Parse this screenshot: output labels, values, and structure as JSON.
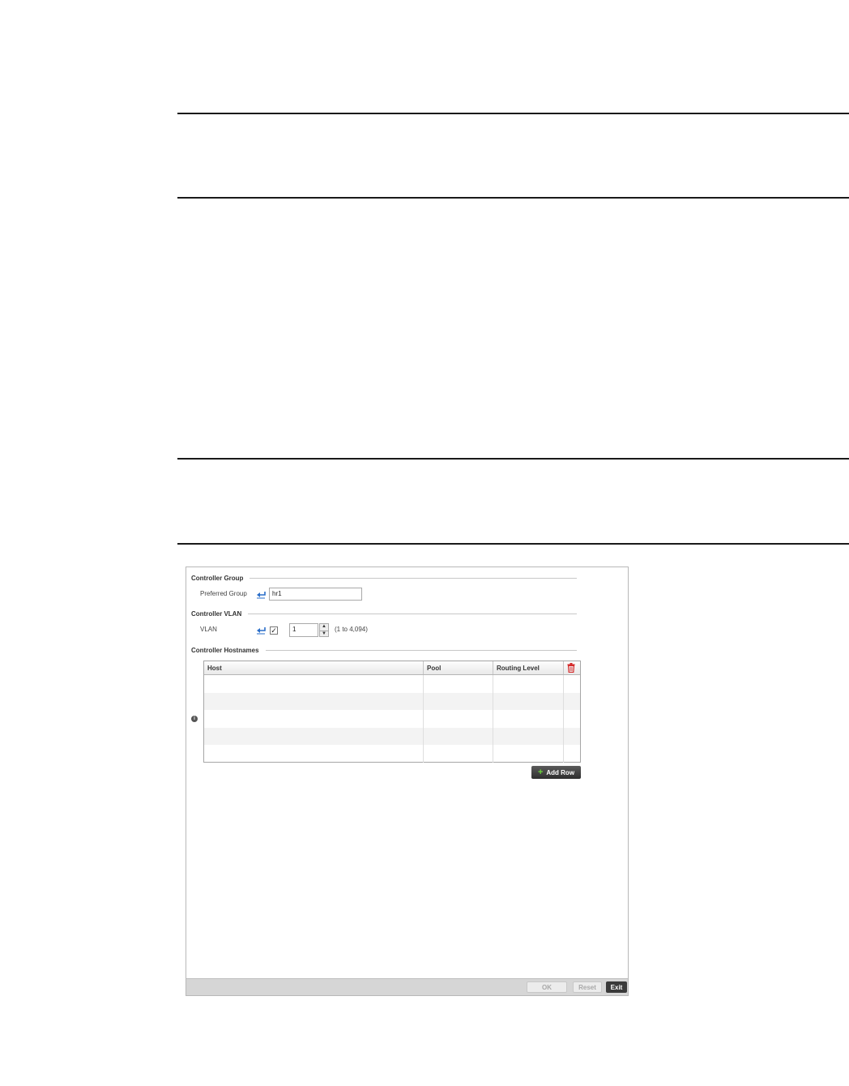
{
  "form": {
    "controller_group": {
      "title": "Controller Group",
      "preferred_group_label": "Preferred Group",
      "preferred_group_value": "hr1"
    },
    "controller_vlan": {
      "title": "Controller VLAN",
      "vlan_label": "VLAN",
      "vlan_checked": "✓",
      "vlan_value": "1",
      "vlan_range": "(1 to 4,094)"
    },
    "controller_hostnames": {
      "title": "Controller Hostnames",
      "columns": {
        "host": "Host",
        "pool": "Pool",
        "routing_level": "Routing Level"
      },
      "info_icon": "i",
      "add_row_label": "Add Row",
      "add_icon": "+"
    }
  },
  "footer": {
    "ok_label": "OK",
    "reset_label": "Reset",
    "exit_label": "Exit"
  },
  "colors": {
    "delete_icon": "#d42b2b",
    "arrow_icon": "#2a6ec9",
    "add_plus": "#6bd43a"
  }
}
